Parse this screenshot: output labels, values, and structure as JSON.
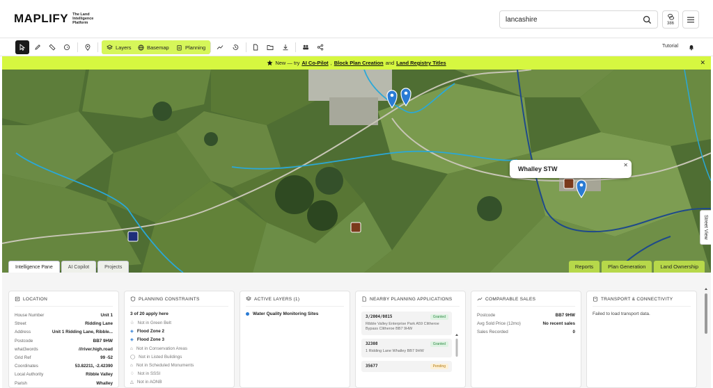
{
  "header": {
    "logo_text": "MAPLIFY",
    "logo_tagline": "The Land Intelligence Platform",
    "search_value": "lancashire",
    "credits": "386"
  },
  "toolbar": {
    "layers_label": "Layers",
    "basemap_label": "Basemap",
    "planning_label": "Planning",
    "tutorial_label": "Tutorial"
  },
  "banner": {
    "prefix": "New — try",
    "link1": "AI Co-Pilot",
    "sep1": ",",
    "link2": "Block Plan Creation",
    "sep2": "and",
    "link3": "Land Registry Titles"
  },
  "map": {
    "popup_title": "Whalley STW",
    "street_view_label": "Street View",
    "tabs": [
      "Intelligence Pane",
      "AI Copilot",
      "Projects"
    ],
    "actions": [
      "Reports",
      "Plan Generation",
      "Land Ownership"
    ]
  },
  "location": {
    "title": "LOCATION",
    "rows": [
      {
        "k": "House Number",
        "v": "Unit 1"
      },
      {
        "k": "Street",
        "v": "Ridding Lane"
      },
      {
        "k": "Address",
        "v": "Unit 1 Ridding Lane, Ribble..."
      },
      {
        "k": "Postcode",
        "v": "BB7 9HW"
      },
      {
        "k": "what3words",
        "v": "///river.high.road"
      },
      {
        "k": "Grid Ref",
        "v": "99 -52"
      },
      {
        "k": "Coordinates",
        "v": "53.82211, -2.42390"
      },
      {
        "k": "Local Authority",
        "v": "Ribble Valley"
      },
      {
        "k": "Parish",
        "v": "Whalley"
      }
    ]
  },
  "planning": {
    "title": "PLANNING CONSTRAINTS",
    "count": "3 of 20 apply here",
    "items": [
      {
        "label": "Not in Green Belt",
        "active": false
      },
      {
        "label": "Flood Zone 2",
        "active": true
      },
      {
        "label": "Flood Zone 3",
        "active": true
      },
      {
        "label": "Not in Conservation Areas",
        "active": false
      },
      {
        "label": "Not in Listed Buildings",
        "active": false
      },
      {
        "label": "Not in Scheduled Monuments",
        "active": false
      },
      {
        "label": "Not in SSSI",
        "active": false
      },
      {
        "label": "Not in AONB",
        "active": false
      }
    ]
  },
  "layers": {
    "title": "ACTIVE LAYERS (1)",
    "items": [
      "Water Quality Monitoring Sites"
    ]
  },
  "applications": {
    "title": "NEARBY PLANNING APPLICATIONS",
    "items": [
      {
        "ref": "3/2004/0815",
        "status": "Granted",
        "address": "Ribble Valley Enterprise Park A59 Clitheroe Bypass Clitheroe BB7 9HW"
      },
      {
        "ref": "32308",
        "status": "Granted",
        "address": "1 Ridding Lane Whalley BB7 9HW"
      },
      {
        "ref": "35677",
        "status": "Pending",
        "address": ""
      }
    ]
  },
  "sales": {
    "title": "COMPARABLE SALES",
    "rows": [
      {
        "k": "Postcode",
        "v": "BB7 9HW"
      },
      {
        "k": "Avg Sold Price (12mo)",
        "v": "No recent sales"
      },
      {
        "k": "Sales Recorded",
        "v": "0"
      }
    ]
  },
  "transport": {
    "title": "TRANSPORT & CONNECTIVITY",
    "message": "Failed to load transport data."
  },
  "colors": {
    "accent": "#d6f65a",
    "banner": "#d6f740",
    "marker_blue": "#2a7bd4",
    "marker_brown": "#7a3a1c"
  }
}
